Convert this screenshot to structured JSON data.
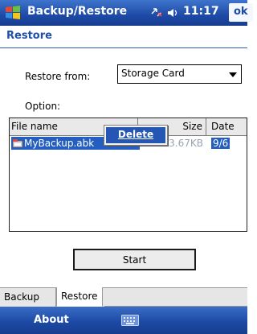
{
  "window": {
    "title": "Backup/Restore",
    "clock": "11:17",
    "ok_label": "ok",
    "icons": {
      "start": "windows-flag-icon",
      "connectivity": "connectivity-icon",
      "volume": "volume-icon"
    }
  },
  "page": {
    "title": "Restore"
  },
  "form": {
    "restore_from_label": "Restore from:",
    "restore_from_value": "Storage Card",
    "option_label": "Option:"
  },
  "file_list": {
    "columns": [
      "File name",
      "Size",
      "Date"
    ],
    "rows": [
      {
        "name": "MyBackup.abk",
        "size": "303.67KB",
        "date": "9/6"
      }
    ]
  },
  "context_menu": {
    "delete_label": "Delete"
  },
  "actions": {
    "start_label": "Start"
  },
  "tabs": [
    {
      "label": "Backup",
      "selected": false
    },
    {
      "label": "Restore",
      "selected": true
    }
  ],
  "softkeys": {
    "left_label": "About",
    "input_icon": "keyboard-icon"
  },
  "colors": {
    "titlebar": "#1d4aa6",
    "accent": "#1f4fa7",
    "selection": "#245ec1"
  }
}
